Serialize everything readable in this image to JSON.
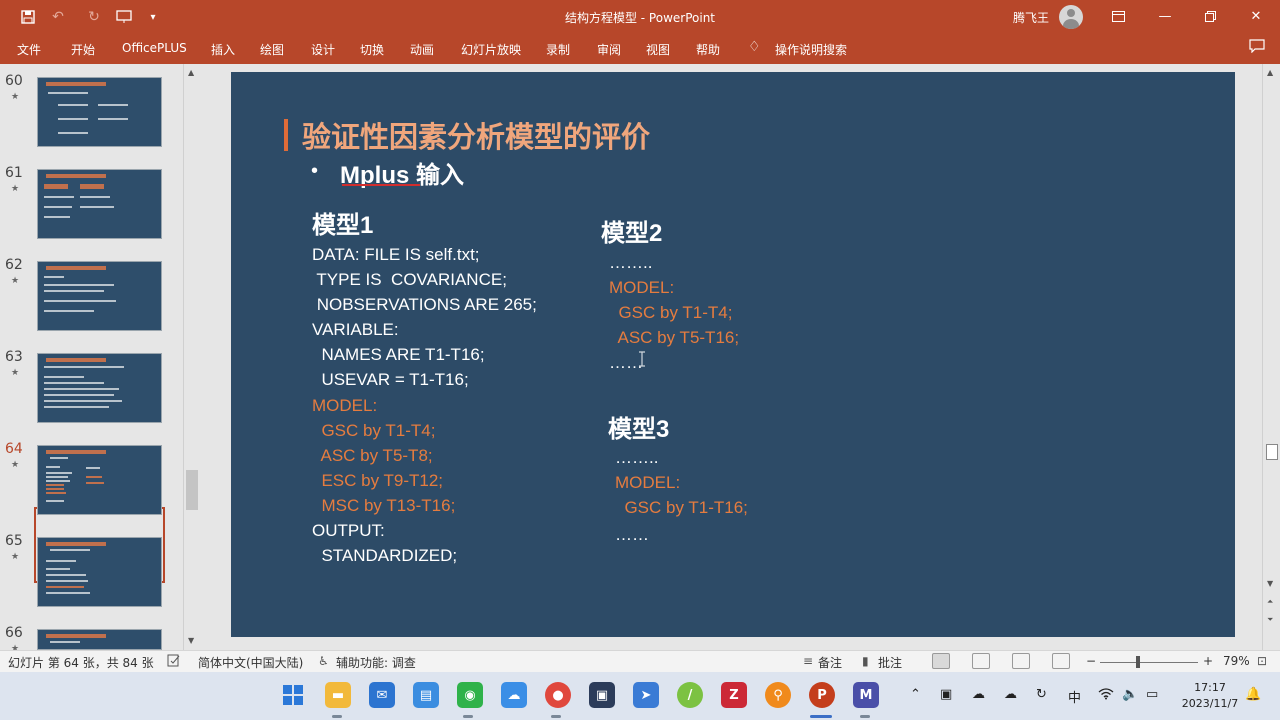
{
  "window": {
    "title": "结构方程模型 - PowerPoint",
    "user_name": "腾飞王"
  },
  "quick_access": [
    {
      "icon": "save-icon"
    },
    {
      "icon": "undo-icon"
    },
    {
      "icon": "redo-icon"
    },
    {
      "icon": "present-from-start-icon"
    },
    {
      "icon": "customize-qat-icon"
    }
  ],
  "ribbon": {
    "tabs": [
      "文件",
      "开始",
      "OfficePLUS",
      "插入",
      "绘图",
      "设计",
      "切换",
      "动画",
      "幻灯片放映",
      "录制",
      "审阅",
      "视图",
      "帮助"
    ],
    "search_label": "操作说明搜索"
  },
  "slides_pane": {
    "items": [
      {
        "number": "60"
      },
      {
        "number": "61"
      },
      {
        "number": "62"
      },
      {
        "number": "63"
      },
      {
        "number": "64",
        "selected": true
      },
      {
        "number": "65"
      },
      {
        "number": "66"
      }
    ],
    "star_glyph": "★"
  },
  "slide": {
    "title": "验证性因素分析模型的评价",
    "bullet": "•",
    "subtitle": "Mplus 输入",
    "model1": {
      "heading": "模型1",
      "lines_white": [
        "DATA: FILE IS self.txt;",
        " TYPE IS  COVARIANCE;",
        " NOBSERVATIONS ARE 265;",
        "VARIABLE:",
        "  NAMES ARE T1-T16;",
        "  USEVAR = T1-T16;"
      ],
      "model_label": "MODEL:",
      "model_lines": [
        "  GSC by T1-T4;",
        "  ASC by T5-T8;",
        "  ESC by T9-T12;",
        "  MSC by T13-T16;"
      ],
      "output_lines": [
        "OUTPUT:",
        "  STANDARDIZED;"
      ]
    },
    "model2": {
      "heading": "模型2",
      "ellipsis_top": "……..",
      "model_label": "MODEL:",
      "model_lines": [
        "  GSC by T1-T4;",
        "  ASC by T5-T16;"
      ],
      "ellipsis_bottom": "……"
    },
    "model3": {
      "heading": "模型3",
      "ellipsis_top": "……..",
      "model_label": "MODEL:",
      "model_lines": [
        "  GSC by T1-T16;"
      ],
      "ellipsis_bottom": "……"
    }
  },
  "status_bar": {
    "slide_info": "幻灯片 第 64 张，共 84 张",
    "language": "简体中文(中国大陆)",
    "accessibility": "辅助功能: 调查",
    "notes_label": "备注",
    "comments_label": "批注",
    "zoom_minus": "−",
    "zoom_plus": "+",
    "zoom_level": "79%",
    "zoom_fraction": 0.79
  },
  "taskbar": {
    "apps": [
      {
        "icon": "windows-start-icon",
        "color": "#2b78d8"
      },
      {
        "icon": "file-explorer-icon",
        "color": "#f2b93b"
      },
      {
        "icon": "mail-icon",
        "color": "#2c74d0"
      },
      {
        "icon": "files-icon",
        "color": "#3b8de0"
      },
      {
        "icon": "wechat-icon",
        "color": "#2fb24a"
      },
      {
        "icon": "baidu-netdisk-icon",
        "color": "#3a8ee6"
      },
      {
        "icon": "chrome-icon",
        "color": "#e0483d"
      },
      {
        "icon": "app-dark-icon",
        "color": "#2c3c5a"
      },
      {
        "icon": "feishu-icon",
        "color": "#3a7bd5"
      },
      {
        "icon": "app-green-icon",
        "color": "#7cc242"
      },
      {
        "icon": "zotero-icon",
        "color": "#cc2936"
      },
      {
        "icon": "search-app-icon",
        "color": "#f08a1c"
      },
      {
        "icon": "powerpoint-icon",
        "color": "#c43e1c"
      },
      {
        "icon": "mplus-icon",
        "color": "#4a4fa8"
      }
    ],
    "ime": "中",
    "time": "17:17",
    "date": "2023/11/7"
  },
  "colors": {
    "accent": "#b7472a",
    "slide_bg": "#2d4b67",
    "title_orange": "#f0a67c",
    "code_orange": "#e57c3f"
  }
}
